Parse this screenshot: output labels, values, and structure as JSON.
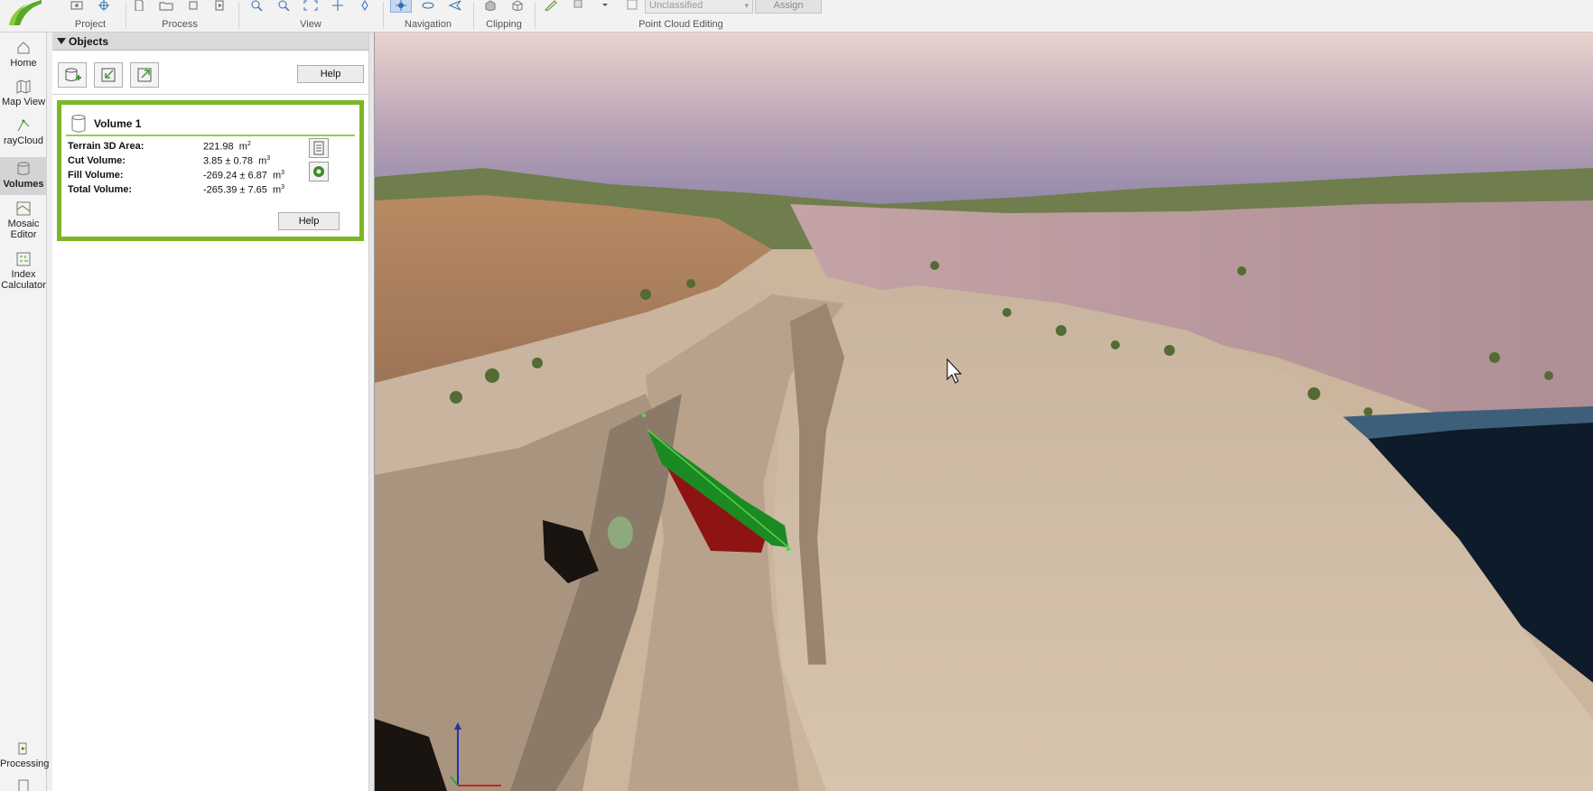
{
  "toolbar": {
    "groups": [
      {
        "label": "Project",
        "icons": [
          "project-settings-icon",
          "crosshair-icon"
        ]
      },
      {
        "label": "Process",
        "icons": [
          "new-file-icon",
          "open-folder-icon",
          "refresh-icon",
          "process-icon"
        ]
      },
      {
        "label": "View",
        "icons": [
          "zoom-in-icon",
          "zoom-out-icon",
          "fit-view-icon",
          "move-icon"
        ]
      },
      {
        "label": "Navigation",
        "icons": [
          "orbit-icon",
          "fly-icon",
          "trackball-icon"
        ]
      },
      {
        "label": "Clipping",
        "icons": [
          "clip-box-icon",
          "clip-cube-icon"
        ]
      },
      {
        "label": "Point Cloud Editing",
        "icons": [
          "brush-icon",
          "select-icon"
        ]
      }
    ],
    "classification": {
      "selected": "Unclassified"
    },
    "assign_label": "Assign"
  },
  "sidebar": {
    "items": [
      {
        "label": "Home",
        "icon": "home-icon"
      },
      {
        "label": "Map View",
        "icon": "map-icon"
      },
      {
        "label": "rayCloud",
        "icon": "raycloud-icon"
      },
      {
        "label": "Volumes",
        "icon": "volumes-icon"
      },
      {
        "label_line1": "Mosaic",
        "label_line2": "Editor",
        "icon": "mosaic-icon"
      },
      {
        "label_line1": "Index",
        "label_line2": "Calculator",
        "icon": "index-icon"
      },
      {
        "label": "Processing",
        "icon": "processing-icon"
      }
    ],
    "active": "Volumes"
  },
  "panel": {
    "title": "Objects",
    "buttons": [
      "new-volume-icon",
      "import-volume-icon",
      "export-volume-icon"
    ],
    "help_label": "Help",
    "volume": {
      "name": "Volume 1",
      "rows": [
        {
          "key": "Terrain 3D Area:",
          "value": "221.98",
          "unit": "m",
          "exp": "2"
        },
        {
          "key": "Cut Volume:",
          "value": "3.85 ± 0.78",
          "unit": "m",
          "exp": "3"
        },
        {
          "key": "Fill Volume:",
          "value": "-269.24 ± 6.87",
          "unit": "m",
          "exp": "3"
        },
        {
          "key": "Total Volume:",
          "value": "-265.39 ± 7.65",
          "unit": "m",
          "exp": "3"
        }
      ],
      "help_label": "Help"
    }
  },
  "colors": {
    "accent_green": "#7db627",
    "volume_top": "#1b8a22",
    "volume_fill": "#8e1414"
  }
}
